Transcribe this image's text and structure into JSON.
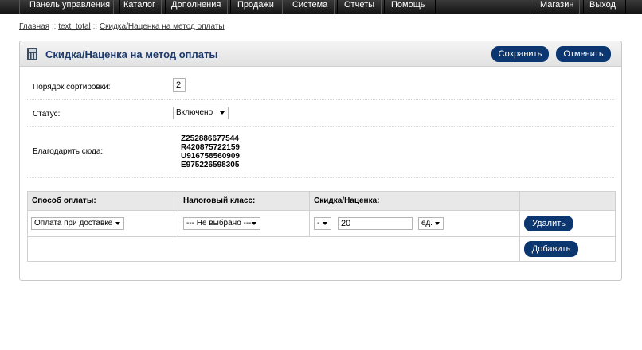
{
  "nav": {
    "items": [
      "Панель управления",
      "Каталог",
      "Дополнения",
      "Продажи",
      "Система",
      "Отчеты",
      "Помощь"
    ],
    "right": [
      "Магазин",
      "Выход"
    ]
  },
  "breadcrumb": {
    "items": [
      "Главная",
      "text_total",
      "Скидка/Наценка на метод оплаты"
    ],
    "separator": "::"
  },
  "panel": {
    "title": "Скидка/Наценка на метод оплаты",
    "save_label": "Сохранить",
    "cancel_label": "Отменить",
    "icon": "calculator-icon"
  },
  "form": {
    "sort_order": {
      "label": "Порядок сортировки:",
      "value": "2"
    },
    "status": {
      "label": "Статус:",
      "value": "Включено"
    },
    "thanks": {
      "label": "Благодарить сюда:",
      "values": [
        "Z252886677544",
        "R420875722159",
        "U916758560909",
        "E975226598305"
      ]
    }
  },
  "table": {
    "headers": [
      "Способ оплаты:",
      "Налоговый класс:",
      "Скидка/Наценка:",
      ""
    ],
    "row": {
      "payment": "Оплата при доставке",
      "tax_class": "--- Не выбрано ---",
      "sign": "-",
      "amount": "20",
      "unit": "ед.",
      "delete_label": "Удалить"
    },
    "add_label": "Добавить"
  },
  "colors": {
    "button": "#0c3670",
    "title": "#1c3a6c",
    "nav_bg": "#1e1e1e"
  }
}
